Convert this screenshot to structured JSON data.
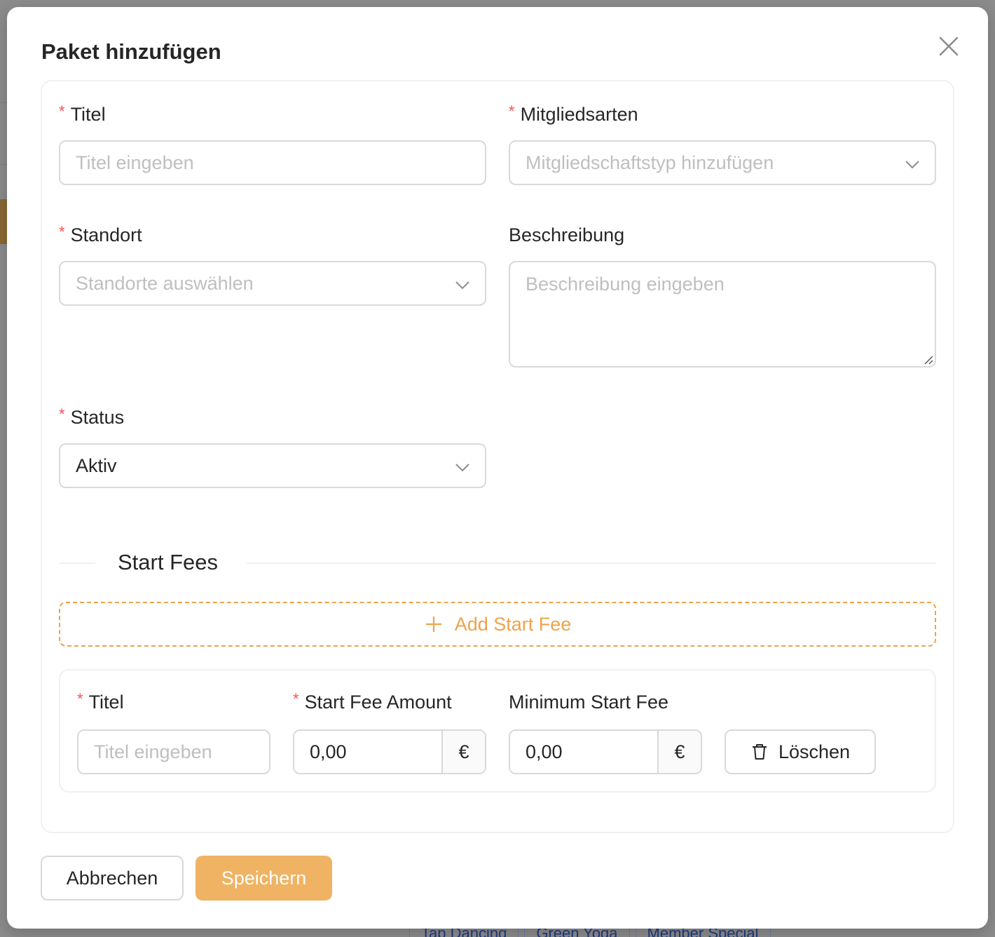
{
  "background": {
    "tags": [
      "Tap Dancing",
      "Green Yoga",
      "Member Special"
    ]
  },
  "modal": {
    "title": "Paket hinzufügen",
    "close_icon": "close-icon"
  },
  "form": {
    "title_field": {
      "label": "Titel",
      "placeholder": "Titel eingeben",
      "value": ""
    },
    "membership_types": {
      "label": "Mitgliedsarten",
      "placeholder": "Mitgliedschaftstyp hinzufügen"
    },
    "location": {
      "label": "Standort",
      "placeholder": "Standorte auswählen"
    },
    "description": {
      "label": "Beschreibung",
      "placeholder": "Beschreibung eingeben",
      "value": ""
    },
    "status": {
      "label": "Status",
      "value": "Aktiv"
    }
  },
  "start_fees": {
    "section_title": "Start Fees",
    "add_label": "Add Start Fee",
    "items": [
      {
        "title_label": "Titel",
        "title_placeholder": "Titel eingeben",
        "amount_label": "Start Fee Amount",
        "amount_value": "0,00",
        "minimum_label": "Minimum Start Fee",
        "minimum_value": "0,00",
        "currency": "€",
        "delete_label": "Löschen"
      }
    ]
  },
  "footer": {
    "cancel_label": "Abbrechen",
    "save_label": "Speichern"
  },
  "colors": {
    "primary": "#efb363",
    "accent": "#eda34b",
    "required": "#ff4d4f",
    "border": "#d9d9d9",
    "placeholder": "#bfbfbf"
  }
}
